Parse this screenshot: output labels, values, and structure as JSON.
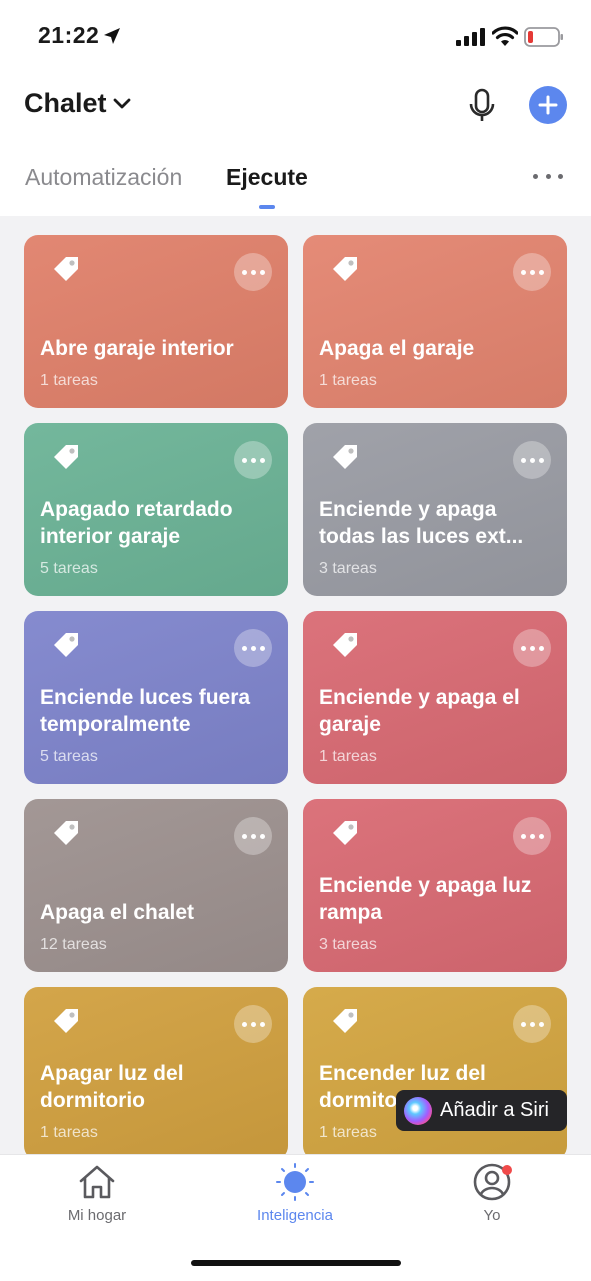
{
  "status_bar": {
    "time": "21:22"
  },
  "header": {
    "home_name": "Chalet",
    "tabs": [
      {
        "label": "Automatización",
        "active": false
      },
      {
        "label": "Ejecute",
        "active": true
      }
    ],
    "accent_color": "#5c87ee"
  },
  "scenes": [
    {
      "name": "Abre garaje interior",
      "tasks": "1 tareas",
      "color": "#e0806a"
    },
    {
      "name": "Apaga el garaje",
      "tasks": "1 tareas",
      "color": "#e3846f"
    },
    {
      "name": "Apagado retardado interior garaje",
      "tasks": "5 tareas",
      "color": "#6bb396"
    },
    {
      "name": "Enciende y apaga todas las luces ext...",
      "tasks": "3 tareas",
      "color": "#9a9ca4"
    },
    {
      "name": "Enciende luces fuera temporalmente",
      "tasks": "5 tareas",
      "color": "#7e84cc"
    },
    {
      "name": "Enciende y apaga el garaje",
      "tasks": "1 tareas",
      "color": "#d96a73"
    },
    {
      "name": "Apaga el chalet",
      "tasks": "12 tareas",
      "color": "#9d918f"
    },
    {
      "name": "Enciende y apaga luz rampa",
      "tasks": "3 tareas",
      "color": "#d96a73"
    },
    {
      "name": "Apagar luz del dormitorio",
      "tasks": "1 tareas",
      "color": "#d1a03f"
    },
    {
      "name": "Encender luz del dormitorio",
      "tasks": "1 tareas",
      "color": "#d3a540"
    }
  ],
  "siri_button": {
    "label": "Añadir a Siri"
  },
  "tab_bar": [
    {
      "label": "Mi hogar",
      "icon": "house-icon",
      "active": false
    },
    {
      "label": "Inteligencia",
      "icon": "sun-icon",
      "active": true
    },
    {
      "label": "Yo",
      "icon": "profile-icon",
      "active": false
    }
  ]
}
